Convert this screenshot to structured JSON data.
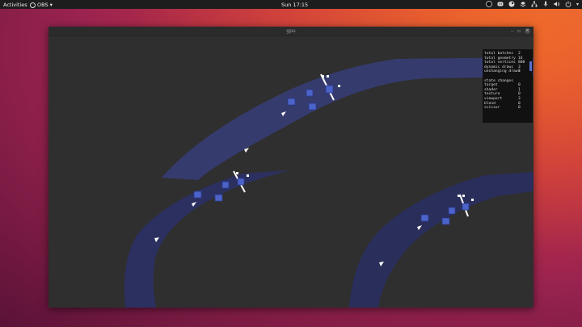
{
  "topbar": {
    "activities": "Activities",
    "app_name": "OBS",
    "clock": "Sun 17:15",
    "tray_icons": [
      "obs-icon",
      "discord-icon",
      "steam-icon",
      "dropbox-icon",
      "network-icon",
      "microphone-icon",
      "volume-icon",
      "power-icon"
    ]
  },
  "window": {
    "title": "gpu",
    "buttons": {
      "minimize": "–",
      "maximize": "▫",
      "close": "×"
    }
  },
  "stats": {
    "summary": [
      {
        "label": "total batches",
        "value": "2"
      },
      {
        "label": "total geometry",
        "value": "16"
      },
      {
        "label": "total vertices",
        "value": "800"
      },
      {
        "label": "dynamic draws",
        "value": "3"
      },
      {
        "label": "unchanging draws",
        "value": "3"
      }
    ],
    "section_title": "state changes",
    "changes": [
      {
        "label": "target",
        "value": "0"
      },
      {
        "label": "shader",
        "value": "1"
      },
      {
        "label": "texture",
        "value": "0"
      },
      {
        "label": "viewport",
        "value": "3"
      },
      {
        "label": "blend",
        "value": "0"
      },
      {
        "label": "scissor",
        "value": "0"
      }
    ]
  },
  "colors": {
    "track": "#363b6e",
    "track_dark": "#2a2e5a",
    "ship": "#ffffff",
    "accent": "#4c63c9"
  }
}
